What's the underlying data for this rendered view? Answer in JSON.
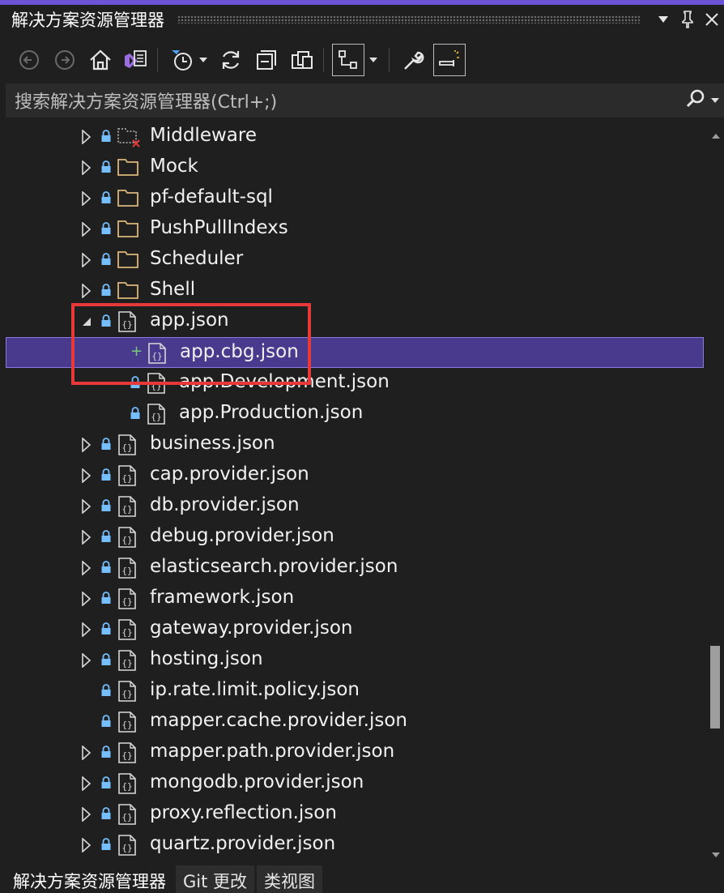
{
  "title": "解决方案资源管理器",
  "search": {
    "placeholder": "搜索解决方案资源管理器(Ctrl+;)"
  },
  "tree": [
    {
      "label": "Middleware",
      "expander": "collapsed",
      "icon": "excluded-folder-icon",
      "lock": true,
      "indent": 0
    },
    {
      "label": "Mock",
      "expander": "collapsed",
      "icon": "folder-icon",
      "lock": true,
      "indent": 0
    },
    {
      "label": "pf-default-sql",
      "expander": "collapsed",
      "icon": "folder-icon",
      "lock": true,
      "indent": 0
    },
    {
      "label": "PushPullIndexs",
      "expander": "collapsed",
      "icon": "folder-icon",
      "lock": true,
      "indent": 0
    },
    {
      "label": "Scheduler",
      "expander": "collapsed",
      "icon": "folder-icon",
      "lock": true,
      "indent": 0
    },
    {
      "label": "Shell",
      "expander": "collapsed",
      "icon": "folder-icon",
      "lock": true,
      "indent": 0
    },
    {
      "label": "app.json",
      "expander": "expanded",
      "icon": "json-file-icon",
      "lock": true,
      "indent": 0
    },
    {
      "label": "app.cbg.json",
      "expander": "none",
      "icon": "json-file-icon",
      "lock": false,
      "plus": true,
      "indent": 1,
      "selected": true
    },
    {
      "label": "app.Development.json",
      "expander": "none",
      "icon": "json-file-icon",
      "lock": true,
      "indent": 1
    },
    {
      "label": "app.Production.json",
      "expander": "none",
      "icon": "json-file-icon",
      "lock": true,
      "indent": 1
    },
    {
      "label": "business.json",
      "expander": "collapsed",
      "icon": "json-file-icon",
      "lock": true,
      "indent": 0
    },
    {
      "label": "cap.provider.json",
      "expander": "collapsed",
      "icon": "json-file-icon",
      "lock": true,
      "indent": 0
    },
    {
      "label": "db.provider.json",
      "expander": "collapsed",
      "icon": "json-file-icon",
      "lock": true,
      "indent": 0
    },
    {
      "label": "debug.provider.json",
      "expander": "collapsed",
      "icon": "json-file-icon",
      "lock": true,
      "indent": 0
    },
    {
      "label": "elasticsearch.provider.json",
      "expander": "collapsed",
      "icon": "json-file-icon",
      "lock": true,
      "indent": 0
    },
    {
      "label": "framework.json",
      "expander": "collapsed",
      "icon": "json-file-icon",
      "lock": true,
      "indent": 0
    },
    {
      "label": "gateway.provider.json",
      "expander": "collapsed",
      "icon": "json-file-icon",
      "lock": true,
      "indent": 0
    },
    {
      "label": "hosting.json",
      "expander": "collapsed",
      "icon": "json-file-icon",
      "lock": true,
      "indent": 0
    },
    {
      "label": "ip.rate.limit.policy.json",
      "expander": "none",
      "icon": "json-file-icon",
      "lock": true,
      "indent": 0
    },
    {
      "label": "mapper.cache.provider.json",
      "expander": "none",
      "icon": "json-file-icon",
      "lock": true,
      "indent": 0
    },
    {
      "label": "mapper.path.provider.json",
      "expander": "collapsed",
      "icon": "json-file-icon",
      "lock": true,
      "indent": 0
    },
    {
      "label": "mongodb.provider.json",
      "expander": "collapsed",
      "icon": "json-file-icon",
      "lock": true,
      "indent": 0
    },
    {
      "label": "proxy.reflection.json",
      "expander": "collapsed",
      "icon": "json-file-icon",
      "lock": true,
      "indent": 0
    },
    {
      "label": "quartz.provider.json",
      "expander": "collapsed",
      "icon": "json-file-icon",
      "lock": true,
      "indent": 0
    }
  ],
  "tabs": [
    {
      "label": "解决方案资源管理器",
      "active": true
    },
    {
      "label": "Git 更改",
      "active": false
    },
    {
      "label": "类视图",
      "active": false
    }
  ],
  "colors": {
    "accent": "#6c52d4",
    "selection": "#4a3a8e",
    "highlight_box": "#e8393a",
    "folder": "#dcb67a",
    "lock": "#75beff"
  }
}
